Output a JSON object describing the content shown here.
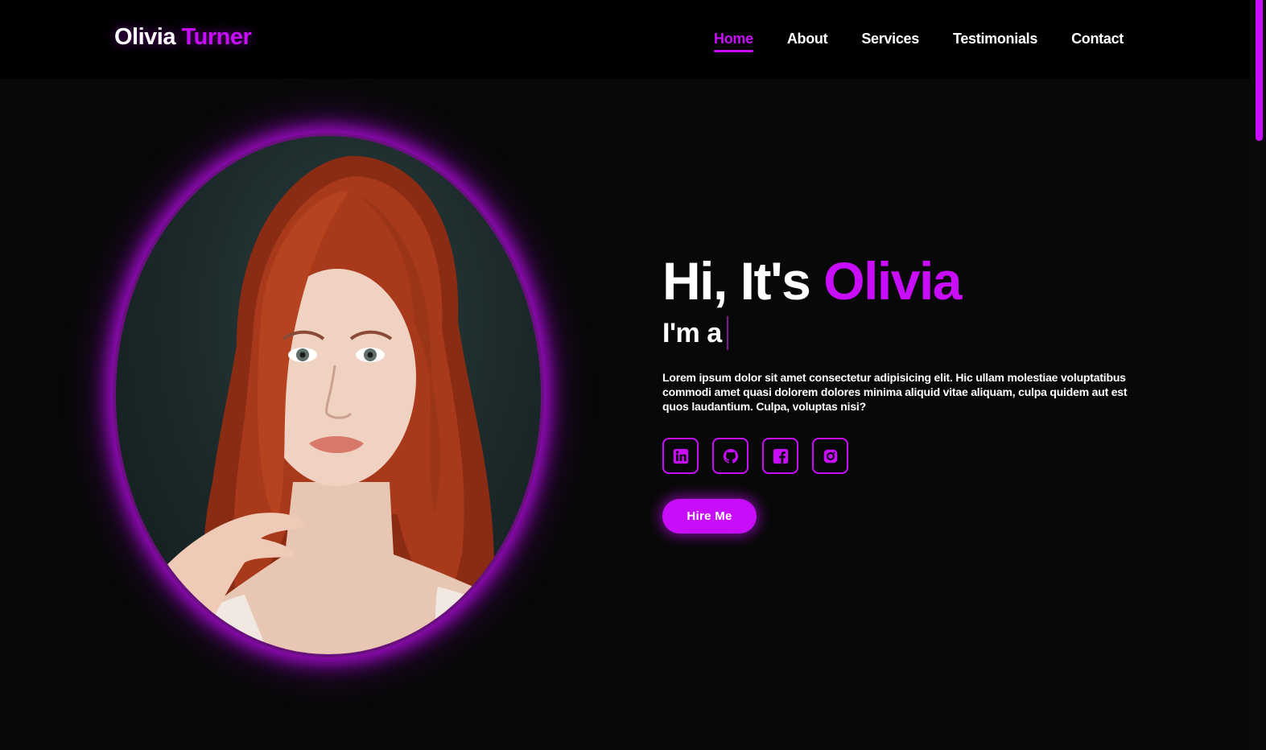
{
  "colors": {
    "accent": "#c80dfa",
    "background": "#080808",
    "header": "#000000"
  },
  "logo": {
    "first": "Olivia",
    "last": "Turner"
  },
  "nav": {
    "items": [
      {
        "label": "Home",
        "active": true
      },
      {
        "label": "About"
      },
      {
        "label": "Services"
      },
      {
        "label": "Testimonials"
      },
      {
        "label": "Contact"
      }
    ]
  },
  "hero": {
    "greeting": "Hi, It's",
    "name": "Olivia",
    "role_prefix": "I'm a",
    "description": "Lorem ipsum dolor sit amet consectetur adipisicing elit. Hic ullam molestiae voluptatibus commodi amet quasi dolorem dolores minima aliquid vitae aliquam, culpa quidem aut est quos laudantium. Culpa, voluptas nisi?",
    "socials": [
      {
        "icon": "linkedin-icon"
      },
      {
        "icon": "github-icon"
      },
      {
        "icon": "facebook-icon"
      },
      {
        "icon": "instagram-icon"
      }
    ],
    "cta_label": "Hire Me"
  }
}
